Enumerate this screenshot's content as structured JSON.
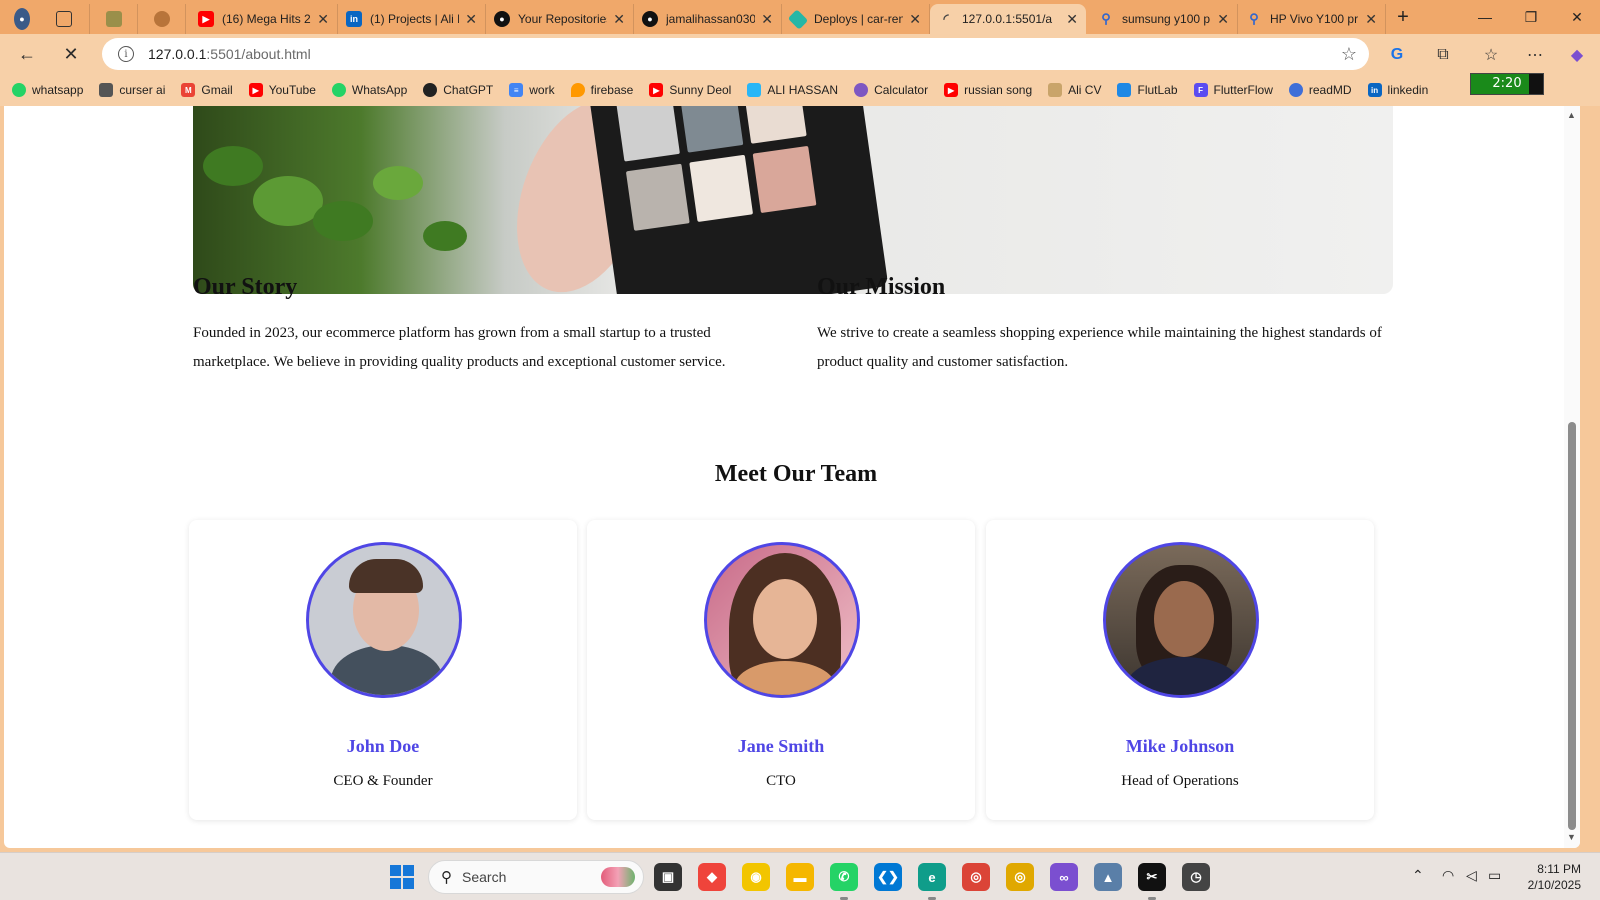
{
  "browser": {
    "tabs": [
      {
        "title": "",
        "icon": "profile-avatar",
        "color": "#3a5a88"
      },
      {
        "title": "",
        "icon": "workspaces-icon",
        "color": "#666666"
      },
      {
        "title": "",
        "icon": "app-icon",
        "color": "#9a8f4a"
      },
      {
        "title": "",
        "icon": "circle-app-icon",
        "color": "#b8743a"
      },
      {
        "title": "(16) Mega Hits 2",
        "icon": "youtube-icon",
        "color": "#ff0000"
      },
      {
        "title": "(1) Projects | Ali H",
        "icon": "linkedin-icon",
        "color": "#0a66c2"
      },
      {
        "title": "Your Repositories",
        "icon": "github-icon",
        "color": "#111111"
      },
      {
        "title": "jamalihassan030",
        "icon": "github-icon",
        "color": "#111111"
      },
      {
        "title": "Deploys | car-ren",
        "icon": "netlify-icon",
        "color": "#25b7a6"
      },
      {
        "title": "127.0.0.1:5501/a",
        "icon": "loading-icon",
        "color": "#555555"
      },
      {
        "title": "sumsung y100 p",
        "icon": "search-tab-icon",
        "color": "#3366cc"
      },
      {
        "title": "HP Vivo Y100 pr",
        "icon": "search-tab-icon",
        "color": "#3366cc"
      }
    ],
    "new_tab": "+",
    "window": {
      "minimize": "—",
      "restore": "❐",
      "close": "✕"
    },
    "address": {
      "host": "127.0.0.1",
      "path": ":5501/about.html"
    },
    "bookmarks": [
      {
        "label": "whatsapp",
        "color": "#25d366"
      },
      {
        "label": "curser ai",
        "color": "#555555"
      },
      {
        "label": "Gmail",
        "color": "#ea4335"
      },
      {
        "label": "YouTube",
        "color": "#ff0000"
      },
      {
        "label": "WhatsApp",
        "color": "#25d366"
      },
      {
        "label": "ChatGPT",
        "color": "#222222"
      },
      {
        "label": "work",
        "color": "#4285f4"
      },
      {
        "label": "firebase",
        "color": "#ff9800"
      },
      {
        "label": "Sunny Deol",
        "color": "#ff0000"
      },
      {
        "label": "ALI HASSAN",
        "color": "#29b6f6"
      },
      {
        "label": "Calculator",
        "color": "#7e57c2"
      },
      {
        "label": "russian song",
        "color": "#ff0000"
      },
      {
        "label": "Ali CV",
        "color": "#c9a46a"
      },
      {
        "label": "FlutLab",
        "color": "#1e88e5"
      },
      {
        "label": "FlutterFlow",
        "color": "#5b4cf0"
      },
      {
        "label": "readMD",
        "color": "#3f6fd8"
      },
      {
        "label": "linkedin",
        "color": "#0a66c2"
      }
    ],
    "battery": {
      "time": "2:20",
      "level": 0.8
    }
  },
  "page": {
    "story": {
      "title": "Our Story",
      "body": "Founded in 2023, our ecommerce platform has grown from a small startup to a trusted marketplace. We believe in providing quality products and exceptional customer service."
    },
    "mission": {
      "title": "Our Mission",
      "body": "We strive to create a seamless shopping experience while maintaining the highest standards of product quality and customer satisfaction."
    },
    "team": {
      "title": "Meet Our Team",
      "members": [
        {
          "name": "John Doe",
          "role": "CEO & Founder"
        },
        {
          "name": "Jane Smith",
          "role": "CTO"
        },
        {
          "name": "Mike Johnson",
          "role": "Head of Operations"
        }
      ]
    },
    "accent_color": "#4f46e5"
  },
  "taskbar": {
    "search_placeholder": "Search",
    "time": "8:11 PM",
    "date": "2/10/2025",
    "apps": [
      {
        "name": "task-view-icon",
        "color": "#333333"
      },
      {
        "name": "anydesk-icon",
        "color": "#ef443b"
      },
      {
        "name": "chat-app-icon",
        "color": "#f2c500"
      },
      {
        "name": "file-explorer-icon",
        "color": "#f5b700"
      },
      {
        "name": "whatsapp-icon",
        "color": "#25d366"
      },
      {
        "name": "vscode-icon",
        "color": "#0078d4"
      },
      {
        "name": "edge-icon",
        "color": "#0f9d8a"
      },
      {
        "name": "chrome-icon",
        "color": "#db4437"
      },
      {
        "name": "chrome-canary-icon",
        "color": "#e0a800"
      },
      {
        "name": "visual-studio-icon",
        "color": "#7b4fd0"
      },
      {
        "name": "chart-app-icon",
        "color": "#5a7fa8"
      },
      {
        "name": "capcut-icon",
        "color": "#111111"
      },
      {
        "name": "clock-app-icon",
        "color": "#444444"
      }
    ]
  }
}
